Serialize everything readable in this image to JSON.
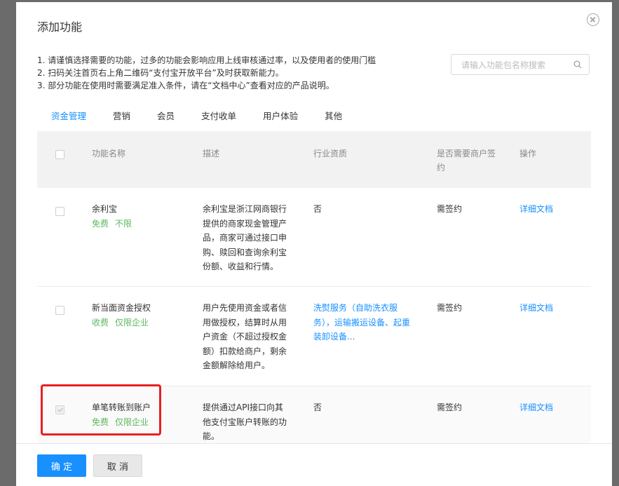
{
  "dialog": {
    "title": "添加功能"
  },
  "notes": [
    "1. 请谨慎选择需要的功能，过多的功能会影响应用上线审核通过率，以及使用者的使用门槛",
    "2. 扫码关注首页右上角二维码“支付宝开放平台”及时获取新能力。",
    "3. 部分功能在使用时需要满足准入条件，请在“文档中心”查看对应的产品说明。"
  ],
  "search": {
    "placeholder": "请输入功能包名称搜索",
    "icon": "search-icon"
  },
  "tabs": [
    {
      "label": "资金管理",
      "active": true
    },
    {
      "label": "营销",
      "active": false
    },
    {
      "label": "会员",
      "active": false
    },
    {
      "label": "支付收单",
      "active": false
    },
    {
      "label": "用户体验",
      "active": false
    },
    {
      "label": "其他",
      "active": false
    }
  ],
  "table": {
    "headers": {
      "name": "功能名称",
      "desc": "描述",
      "qual_line1": "行业资质",
      "sign_line1": "是否需要商户签",
      "sign_line2": "约",
      "action": "操作"
    },
    "rows": [
      {
        "checked": false,
        "name": "余利宝",
        "tag1": "免费",
        "tag2": "不限",
        "desc": [
          "余利宝是浙江网商银行",
          "提供的商家现金管理产",
          "品，商家可通过接口申",
          "购、赎回和查询余利宝",
          "份额、收益和行情。"
        ],
        "qual": "否",
        "sign": "需签约",
        "action": "详细文档"
      },
      {
        "checked": false,
        "name": "新当面资金授权",
        "tag1": "收费",
        "tag2": "仅限企业",
        "desc": [
          "用户先使用资金或者信",
          "用做授权，结算时从用",
          "户资金（不超过授权金",
          "额）扣款给商户，剩余",
          "金额解除给用户。"
        ],
        "qual_lines": [
          "洗熨服务（自助洗衣服",
          "务），运输搬运设备、起重",
          "装卸设备..."
        ],
        "sign": "需签约",
        "action": "详细文档"
      },
      {
        "checked": true,
        "name": "单笔转账到账户",
        "tag1": "免费",
        "tag2": "仅限企业",
        "desc": [
          "提供通过API接口向其",
          "他支付宝账户转账的功",
          "能。"
        ],
        "qual": "否",
        "sign": "需签约",
        "action": "详细文档"
      }
    ]
  },
  "footer": {
    "ok": "确 定",
    "cancel": "取 消"
  },
  "colors": {
    "primary": "#1890ff",
    "tag_green": "#5cb85c",
    "highlight": "#e82020"
  }
}
